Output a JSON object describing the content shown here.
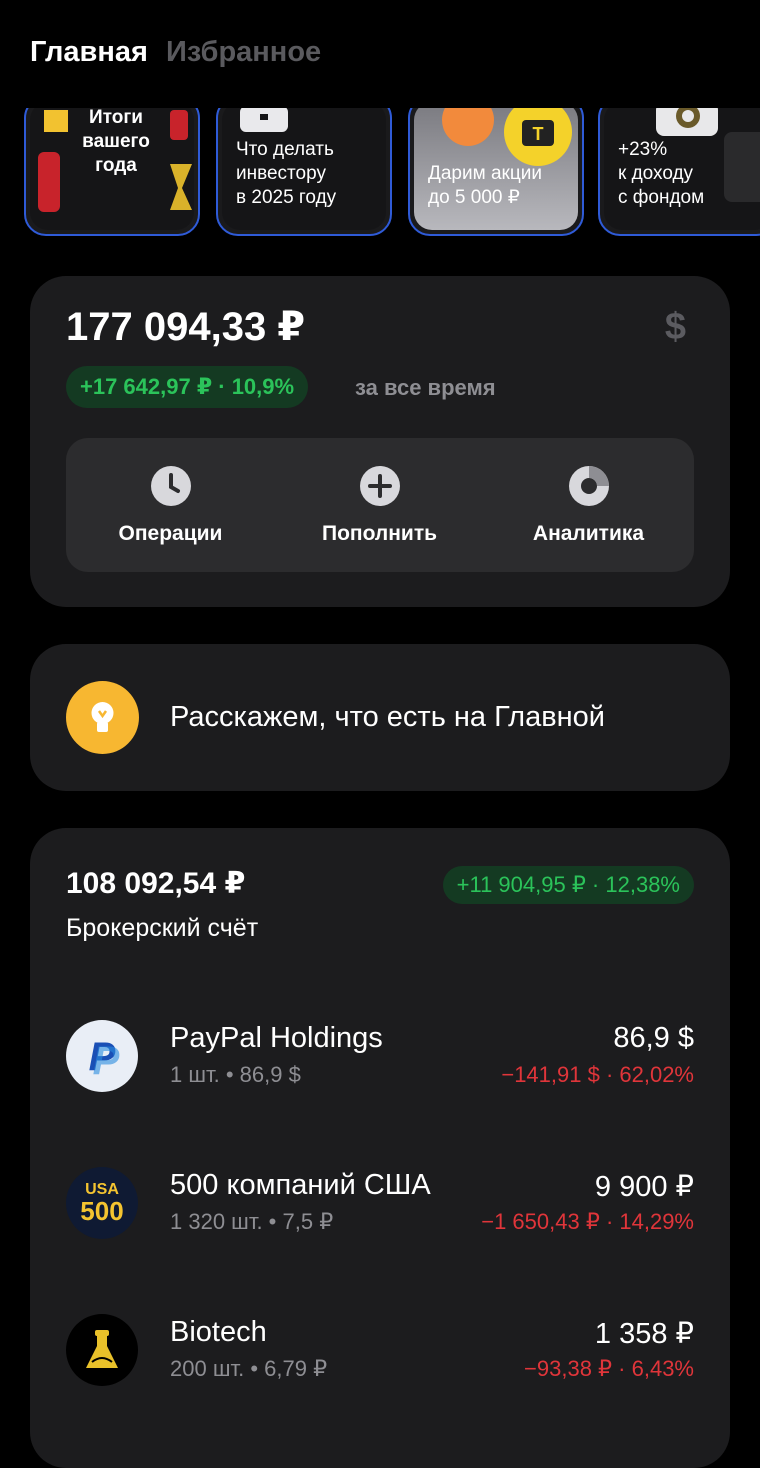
{
  "tabs": {
    "active": "Главная",
    "inactive": "Избранное"
  },
  "stories": [
    {
      "text": "Итоги\nвашего\nгода"
    },
    {
      "text": "Что делать\nинвестору\nв 2025 году"
    },
    {
      "text": "Дарим акции\nдо 5 000 ₽"
    },
    {
      "text": "+23%\nк доходу\nс фондом"
    }
  ],
  "portfolio": {
    "total": "177 094,33 ₽",
    "currency_symbol": "$",
    "gain": "+17 642,97 ₽ · 10,9%",
    "period": "за все время",
    "actions": [
      {
        "label": "Операции",
        "icon": "clock-icon"
      },
      {
        "label": "Пополнить",
        "icon": "plus-icon"
      },
      {
        "label": "Аналитика",
        "icon": "pie-chart-icon"
      }
    ]
  },
  "tip": {
    "text": "Расскажем, что есть на Главной",
    "icon": "lightbulb-icon"
  },
  "account": {
    "total": "108 092,54 ₽",
    "gain": "+11 904,95 ₽ · 12,38%",
    "name": "Брокерский счёт",
    "holdings": [
      {
        "name": "PayPal Holdings",
        "qty": "1 шт. • 86,9 $",
        "value": "86,9 $",
        "change": "−141,91 $ · 62,02%",
        "logo": "paypal-logo"
      },
      {
        "name": "500 компаний США",
        "qty": "1 320 шт. • 7,5 ₽",
        "value": "9 900 ₽",
        "change": "−1 650,43 ₽ · 14,29%",
        "logo": "usa500-logo",
        "logo_text": [
          "USA",
          "500"
        ]
      },
      {
        "name": "Biotech",
        "qty": "200 шт. • 6,79 ₽",
        "value": "1 358 ₽",
        "change": "−93,38 ₽ · 6,43%",
        "logo": "biotech-logo"
      }
    ]
  },
  "colors": {
    "accent_green": "#2bc35a",
    "negative_red": "#e0353a",
    "story_border": "#2f5bd8"
  }
}
